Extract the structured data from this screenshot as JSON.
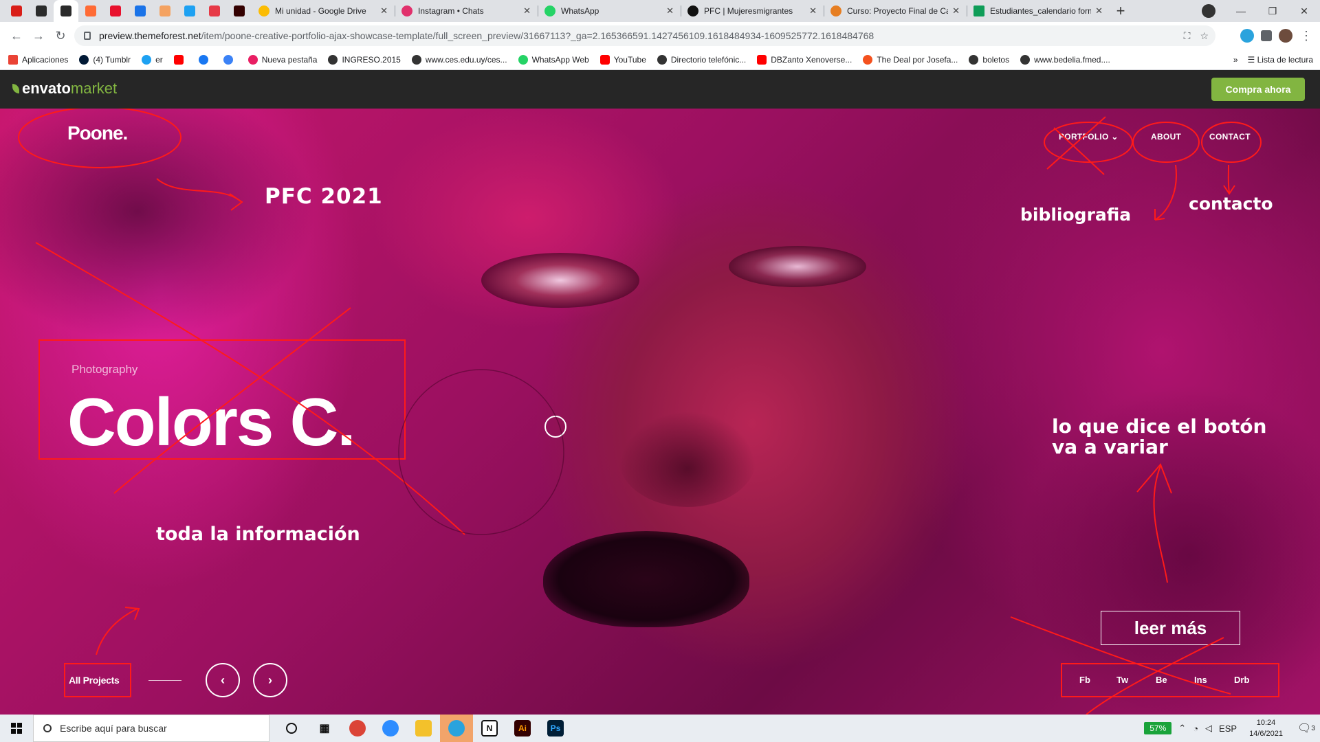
{
  "browser": {
    "tabs": [
      {
        "title": "Mi unidad - Google Drive",
        "color": "#fbbc04"
      },
      {
        "title": "Instagram • Chats",
        "color": "#e1306c"
      },
      {
        "title": "WhatsApp",
        "color": "#25d366"
      },
      {
        "title": "PFC | Mujeresmigrantes",
        "color": "#111111"
      },
      {
        "title": "Curso: Proyecto Final de Ca",
        "color": "#e67e22"
      },
      {
        "title": "Estudiantes_calendario form",
        "color": "#0f9d58"
      }
    ],
    "new_tab": "+",
    "window_controls": {
      "minimize": "—",
      "restore": "❐",
      "close": "✕"
    },
    "url_host": "preview.themeforest.net",
    "url_path": "/item/poone-creative-portfolio-ajax-showcase-template/full_screen_preview/31667113?_ga=2.165366591.1427456109.1618484934-1609525772.1618484768",
    "bookmarks": [
      "Aplicaciones",
      "(4) Tumblr",
      "er",
      "",
      "",
      "",
      "Nueva pestaña",
      "INGRESO.2015",
      "www.ces.edu.uy/ces...",
      "WhatsApp Web",
      "YouTube",
      "Directorio telefónic...",
      "DBZanto Xenoverse...",
      "The Deal por Josefa...",
      "boletos",
      "www.bedelia.fmed...."
    ],
    "bookmarks_more": "»",
    "reading_list": "Lista de lectura"
  },
  "envato": {
    "logo_main": "envato",
    "logo_market": "market",
    "buy_label": "Compra ahora",
    "accent": "#82b541"
  },
  "site": {
    "brand": "Poone.",
    "nav": {
      "portfolio": "PORTFOLIO",
      "about": "ABOUT",
      "contact": "CONTACT"
    },
    "category": "Photography",
    "title": "Colors C.",
    "all_projects": "All Projects",
    "prev": "‹",
    "next": "›",
    "social": [
      "Fb",
      "Tw",
      "Be",
      "Ins",
      "Drb"
    ]
  },
  "annotations": {
    "pfc": "PFC 2021",
    "bibliografia": "bibliografia",
    "contacto": "contacto",
    "boton_note_1": "lo que dice el botón",
    "boton_note_2": "va a variar",
    "info": "toda la información",
    "leer_mas": "leer más",
    "color": "#ff1a1a"
  },
  "taskbar": {
    "search_placeholder": "Escribe aquí para buscar",
    "battery": "57%",
    "language": "ESP",
    "time": "10:24",
    "date": "14/6/2021",
    "notifications": "3"
  }
}
